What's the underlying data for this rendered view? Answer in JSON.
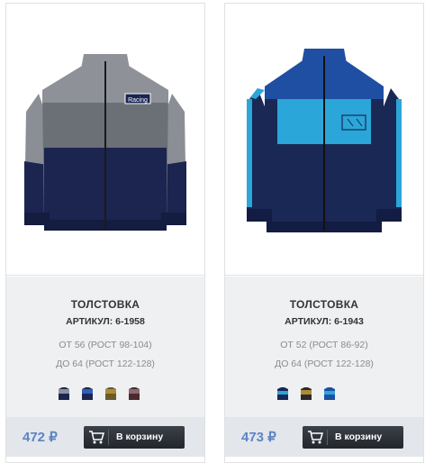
{
  "products": [
    {
      "title": "ТОЛСТОВКА",
      "sku": "АРТИКУЛ: 6-1958",
      "size_from": "ОТ 56 (РОСТ 98-104)",
      "size_to": "ДО 64 (РОСТ 122-128)",
      "price": "472 ₽",
      "cart_label": "В корзину",
      "badge_text": "Racing",
      "colors": {
        "top": "#8a8e94",
        "middle": "#6b6f76",
        "bottom": "#1b2550"
      },
      "swatches": [
        "navy-grey",
        "navy-blue",
        "mustard",
        "burgundy"
      ]
    },
    {
      "title": "ТОЛСТОВКА",
      "sku": "АРТИКУЛ: 6-1943",
      "size_from": "ОТ 52 (РОСТ 86-92)",
      "size_to": "ДО 64 (РОСТ 122-128)",
      "price": "473 ₽",
      "cart_label": "В корзину",
      "badge_text": "",
      "colors": {
        "top": "#1f4fa3",
        "middle": "#2aa6d8",
        "bottom": "#1a2856"
      },
      "swatches": [
        "navy-cyan",
        "mustard",
        "blue"
      ]
    }
  ]
}
